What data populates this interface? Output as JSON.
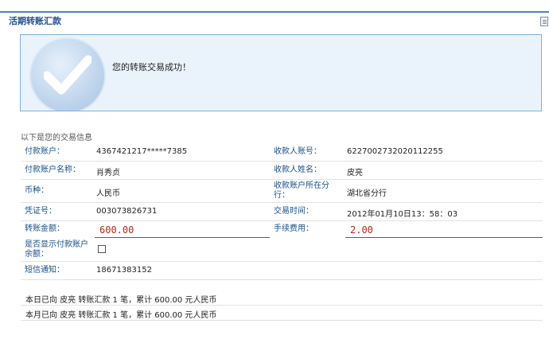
{
  "header": {
    "title": "活期转账汇款"
  },
  "success": {
    "message": "您的转账交易成功！"
  },
  "info": {
    "section_label": "以下是您的交易信息",
    "payer_account_label": "付款账户：",
    "payer_account": "4367421217*****7385",
    "payee_account_label": "收款人账号：",
    "payee_account": "6227002732020112255",
    "payer_name_label": "付款账户名称：",
    "payer_name": "肖秀贞",
    "payee_name_label": "收款人姓名：",
    "payee_name": "皮亮",
    "currency_label": "币种：",
    "currency": "人民币",
    "payee_branch_label": "收款账户所在分行：",
    "payee_branch": "湖北省分行",
    "voucher_label": "凭证号：",
    "voucher": "003073826731",
    "time_label": "交易时间：",
    "time": "2012年01月10日13：58：03",
    "amount_label": "转账金额：",
    "amount": "600.00",
    "fee_label": "手续费用：",
    "fee": "2.00",
    "show_balance_label": "是否显示付款账户余额：",
    "sms_label": "短信通知：",
    "sms": "18671383152"
  },
  "summary": {
    "today": "本日已向 皮亮 转账汇款 1 笔，累计 600.00 元人民币",
    "month": "本月已向 皮亮 转账汇款 1 笔，累计 600.00 元人民币"
  }
}
